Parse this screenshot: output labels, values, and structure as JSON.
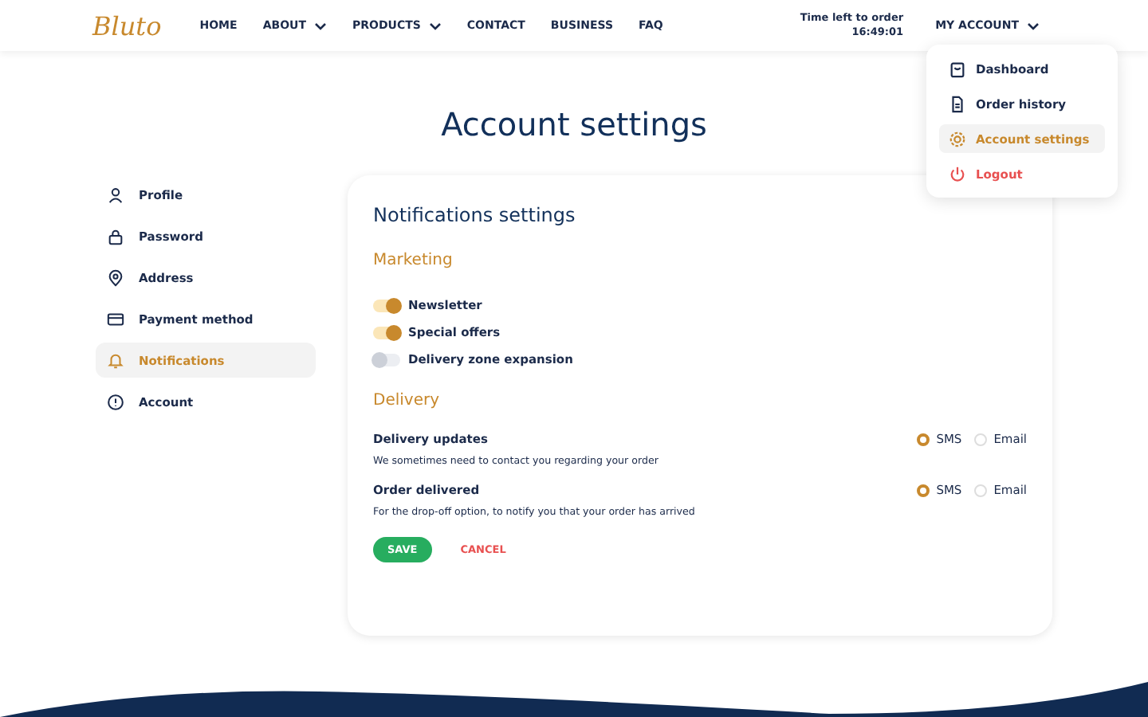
{
  "header": {
    "logo": "Bluto",
    "nav": [
      {
        "label": "HOME",
        "dropdown": false
      },
      {
        "label": "ABOUT",
        "dropdown": true
      },
      {
        "label": "PRODUCTS",
        "dropdown": true
      },
      {
        "label": "CONTACT",
        "dropdown": false
      },
      {
        "label": "BUSINESS",
        "dropdown": false
      },
      {
        "label": "FAQ",
        "dropdown": false
      }
    ],
    "timer_label": "Time left to order",
    "timer": "16:49:01",
    "account": "MY ACCOUNT"
  },
  "account_menu": [
    {
      "label": "Dashboard",
      "selected": false,
      "kind": "normal"
    },
    {
      "label": "Order history",
      "selected": false,
      "kind": "normal"
    },
    {
      "label": "Account settings",
      "selected": true,
      "kind": "normal"
    },
    {
      "label": "Logout",
      "selected": false,
      "kind": "danger"
    }
  ],
  "page_title": "Account settings",
  "sidebar": {
    "items": [
      {
        "label": "Profile",
        "selected": false
      },
      {
        "label": "Password",
        "selected": false
      },
      {
        "label": "Address",
        "selected": false
      },
      {
        "label": "Payment method",
        "selected": false
      },
      {
        "label": "Notifications",
        "selected": true
      },
      {
        "label": "Account",
        "selected": false
      }
    ]
  },
  "card": {
    "title": "Notifications settings",
    "marketing": {
      "heading": "Marketing",
      "toggles": [
        {
          "label": "Newsletter",
          "on": true
        },
        {
          "label": "Special offers",
          "on": true
        },
        {
          "label": "Delivery zone expansion",
          "on": false
        }
      ]
    },
    "delivery": {
      "heading": "Delivery",
      "rows": [
        {
          "title": "Delivery updates",
          "description": "We sometimes need to contact you regarding your order",
          "options": [
            {
              "label": "SMS",
              "selected": true
            },
            {
              "label": "Email",
              "selected": false
            }
          ]
        },
        {
          "title": "Order delivered",
          "description": "For the drop-off option, to notify you that your order has arrived",
          "options": [
            {
              "label": "SMS",
              "selected": true
            },
            {
              "label": "Email",
              "selected": false
            }
          ]
        }
      ]
    },
    "buttons": {
      "save": "SAVE",
      "cancel": "CANCEL"
    }
  }
}
